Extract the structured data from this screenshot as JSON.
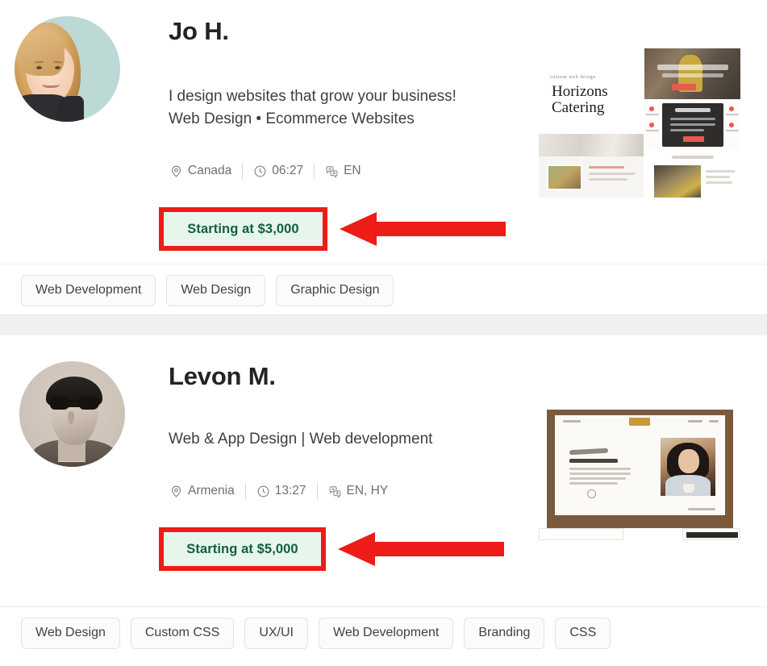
{
  "page": {
    "title": "Freelancer search results",
    "accent_red": "#ed1c16",
    "badge_bg": "#e6f6ed",
    "badge_text_color": "#13603a"
  },
  "profiles": [
    {
      "name": "Jo H.",
      "tagline_line1": "I design websites that grow your business!",
      "tagline_line2": "Web Design • Ecommerce Websites",
      "location": "Canada",
      "location_icon": "map-pin-icon",
      "time": "06:27",
      "time_icon": "clock-icon",
      "languages": "EN",
      "language_icon": "translate-icon",
      "price": "Starting at $3,000",
      "avatar_alt": "Jo H. profile photo",
      "portfolio_alt": "Horizons Catering custom web design",
      "portfolio_text": {
        "eyebrow": "custom web design",
        "title_line1": "Horizons",
        "title_line2": "Catering"
      },
      "tags": [
        "Web Development",
        "Web Design",
        "Graphic Design"
      ]
    },
    {
      "name": "Levon M.",
      "tagline_line1": "Web & App Design | Web development",
      "tagline_line2": "",
      "location": "Armenia",
      "location_icon": "map-pin-icon",
      "time": "13:27",
      "time_icon": "clock-icon",
      "languages": "EN, HY",
      "language_icon": "translate-icon",
      "price": "Starting at $5,000",
      "avatar_alt": "Levon M. profile photo",
      "portfolio_alt": "Web design mockup on desktop frame",
      "portfolio_text": {
        "eyebrow": "",
        "title_line1": "",
        "title_line2": ""
      },
      "tags": [
        "Web Design",
        "Custom CSS",
        "UX/UI",
        "Web Development",
        "Branding",
        "CSS"
      ]
    }
  ],
  "annotations": [
    {
      "name": "arrow-to-price-1",
      "direction": "left",
      "color": "#ed1c16"
    },
    {
      "name": "arrow-to-price-2",
      "direction": "left",
      "color": "#ed1c16"
    }
  ]
}
